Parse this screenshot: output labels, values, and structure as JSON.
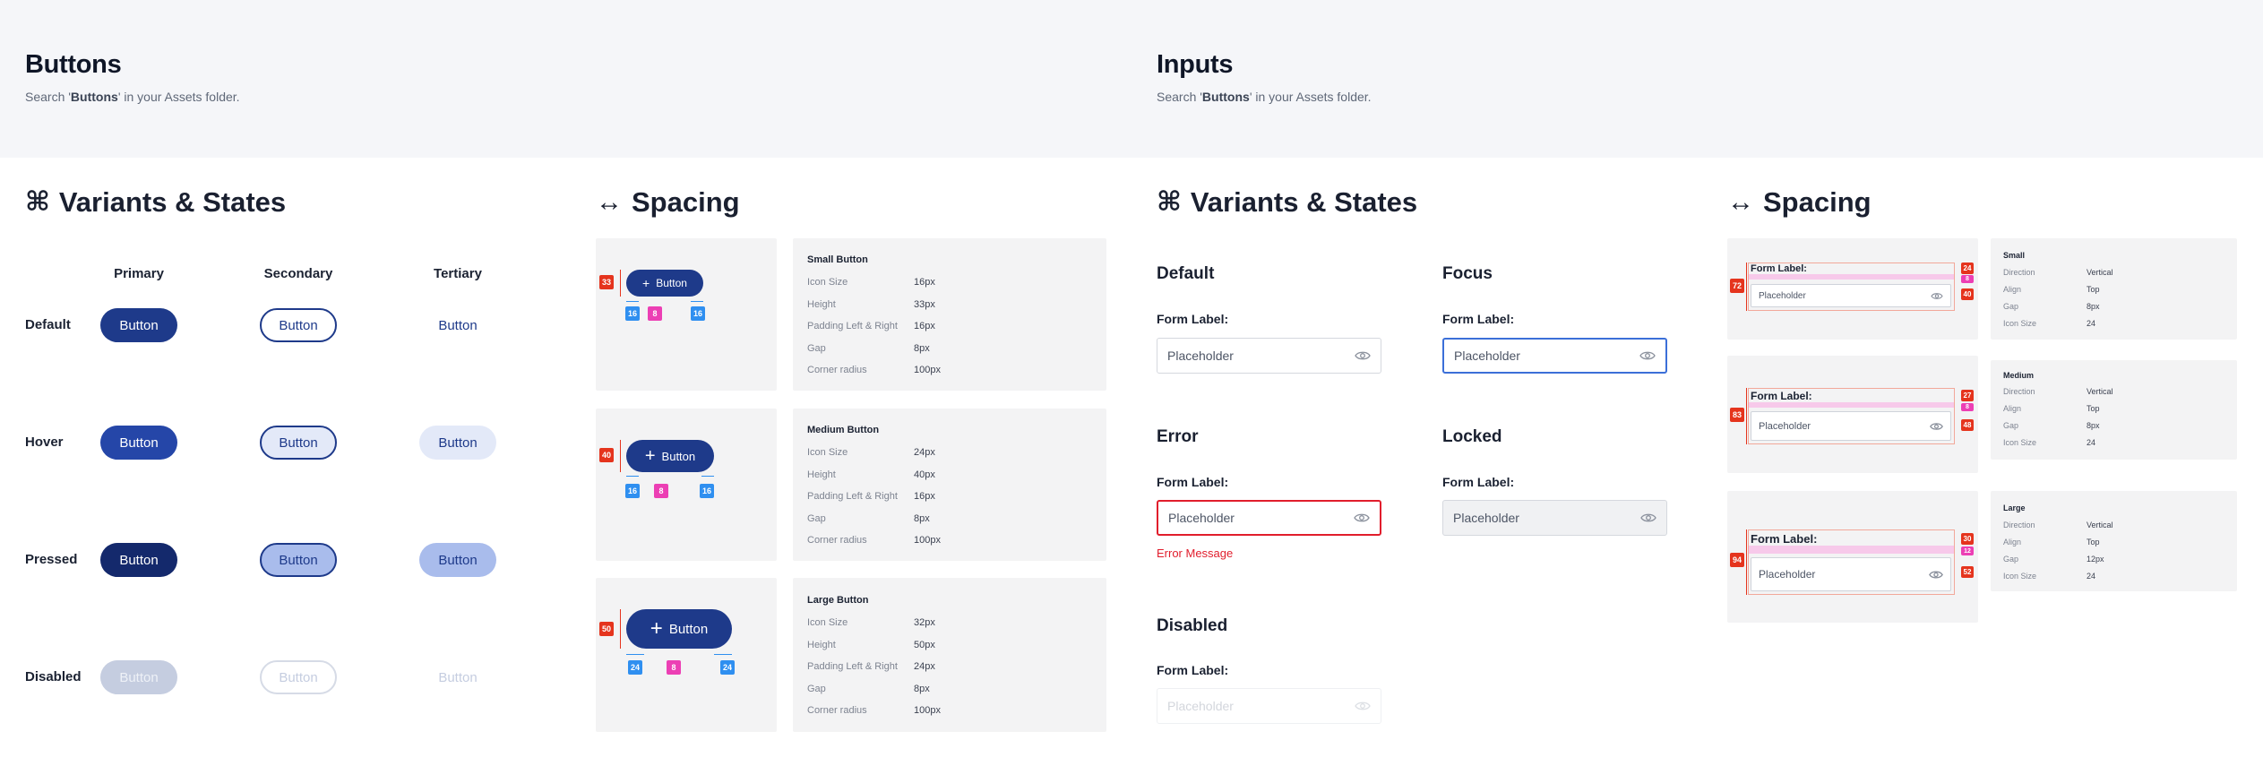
{
  "header": {
    "buttons_title": "Buttons",
    "buttons_sub_pre": "Search '",
    "buttons_sub_bold": "Buttons",
    "buttons_sub_post": "' in your Assets folder.",
    "inputs_title": "Inputs",
    "inputs_sub_pre": "Search '",
    "inputs_sub_bold": "Buttons",
    "inputs_sub_post": "' in your Assets folder."
  },
  "icons": {
    "variants": "command-icon",
    "spacing": "horizontal-arrows-icon",
    "plus": "plus-icon",
    "eye": "eye-icon"
  },
  "colors": {
    "primary": "#1e3a8a",
    "primary_hover": "#2546a8",
    "primary_pressed": "#14296c",
    "primary_disabled": "#c5cde0",
    "error": "#e11d2c",
    "focus": "#3b6fd8",
    "tag_red": "#e5341d",
    "tag_blue": "#2f8ff0",
    "tag_pink": "#ec3fb4"
  },
  "buttons_variants": {
    "title": "Variants & States",
    "columns": [
      "Primary",
      "Secondary",
      "Tertiary"
    ],
    "rows": [
      "Default",
      "Hover",
      "Pressed",
      "Disabled"
    ],
    "button_label": "Button"
  },
  "buttons_spacing": {
    "title": "Spacing",
    "button_label": "Button",
    "sizes": [
      {
        "name": "Small Button",
        "height_tag": "33",
        "left_tag": "16",
        "gap_tag": "8",
        "right_tag": "16",
        "specs": [
          [
            "Icon Size",
            "16px"
          ],
          [
            "Height",
            "33px"
          ],
          [
            "Padding Left & Right",
            "16px"
          ],
          [
            "Gap",
            "8px"
          ],
          [
            "Corner radius",
            "100px"
          ]
        ]
      },
      {
        "name": "Medium Button",
        "height_tag": "40",
        "left_tag": "16",
        "gap_tag": "8",
        "right_tag": "16",
        "specs": [
          [
            "Icon Size",
            "24px"
          ],
          [
            "Height",
            "40px"
          ],
          [
            "Padding Left & Right",
            "16px"
          ],
          [
            "Gap",
            "8px"
          ],
          [
            "Corner radius",
            "100px"
          ]
        ]
      },
      {
        "name": "Large Button",
        "height_tag": "50",
        "left_tag": "24",
        "gap_tag": "8",
        "right_tag": "24",
        "specs": [
          [
            "Icon Size",
            "32px"
          ],
          [
            "Height",
            "50px"
          ],
          [
            "Padding Left & Right",
            "24px"
          ],
          [
            "Gap",
            "8px"
          ],
          [
            "Corner radius",
            "100px"
          ]
        ]
      }
    ]
  },
  "inputs_variants": {
    "title": "Variants & States",
    "form_label": "Form Label:",
    "placeholder": "Placeholder",
    "states": {
      "default": "Default",
      "focus": "Focus",
      "error": "Error",
      "locked": "Locked",
      "disabled": "Disabled"
    },
    "error_message": "Error Message"
  },
  "inputs_spacing": {
    "title": "Spacing",
    "form_label": "Form Label:",
    "placeholder": "Placeholder",
    "sizes": [
      {
        "name": "Small",
        "tag_total": "72",
        "tag_top": "24",
        "tag_gap": "8",
        "tag_field": "40",
        "specs": [
          [
            "Direction",
            "Vertical"
          ],
          [
            "Align",
            "Top"
          ],
          [
            "Gap",
            "8px"
          ],
          [
            "Icon Size",
            "24"
          ]
        ]
      },
      {
        "name": "Medium",
        "tag_total": "83",
        "tag_top": "27",
        "tag_gap": "8",
        "tag_field": "48",
        "specs": [
          [
            "Direction",
            "Vertical"
          ],
          [
            "Align",
            "Top"
          ],
          [
            "Gap",
            "8px"
          ],
          [
            "Icon Size",
            "24"
          ]
        ]
      },
      {
        "name": "Large",
        "tag_total": "94",
        "tag_top": "30",
        "tag_gap": "12",
        "tag_field": "52",
        "specs": [
          [
            "Direction",
            "Vertical"
          ],
          [
            "Align",
            "Top"
          ],
          [
            "Gap",
            "12px"
          ],
          [
            "Icon Size",
            "24"
          ]
        ]
      }
    ]
  }
}
